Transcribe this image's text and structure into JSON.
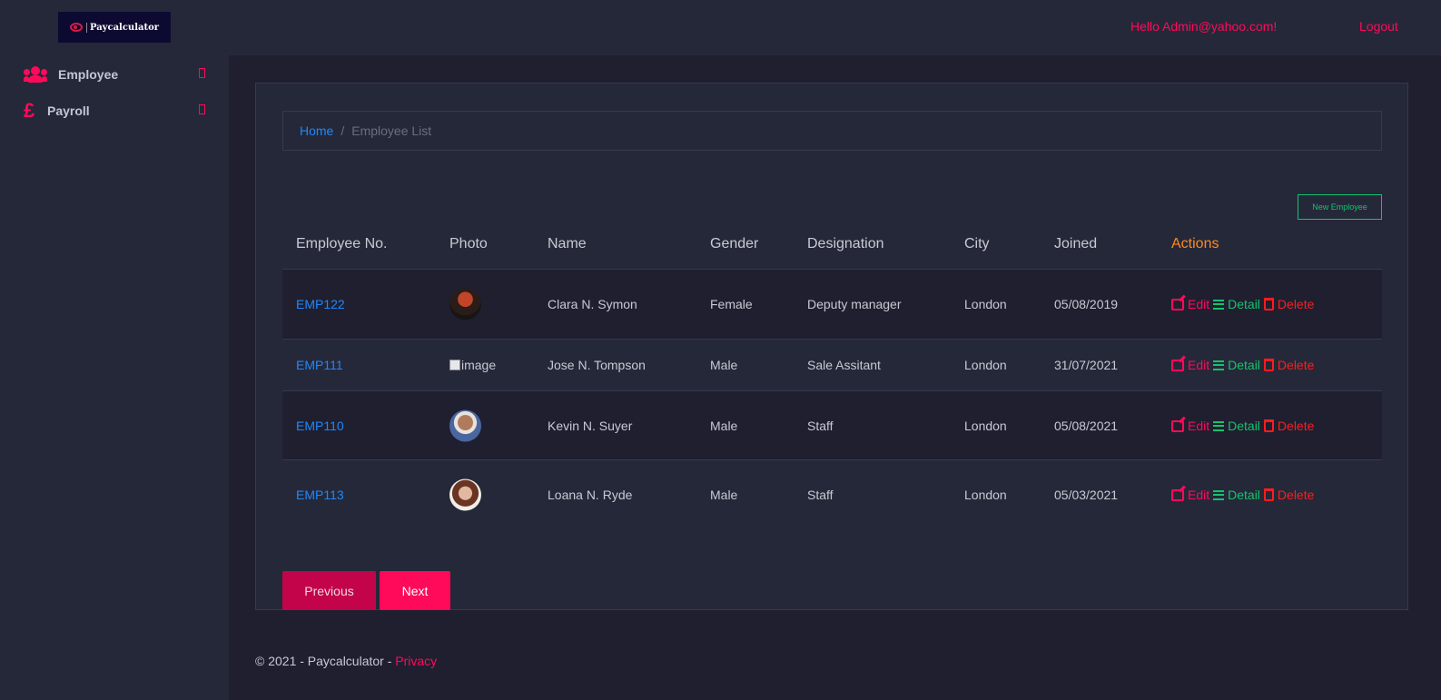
{
  "header": {
    "logo_text": "Paycalculator",
    "greeting": "Hello Admin@yahoo.com!",
    "logout_label": "Logout"
  },
  "sidebar": {
    "items": [
      {
        "label": "Employee",
        "icon": "users-icon"
      },
      {
        "label": "Payroll",
        "icon": "pound-icon"
      }
    ]
  },
  "breadcrumb": {
    "home": "Home",
    "separator": "/",
    "current": "Employee List"
  },
  "new_employee_label": "New Employee",
  "table": {
    "headers": [
      "Employee No.",
      "Photo",
      "Name",
      "Gender",
      "Designation",
      "City",
      "Joined",
      "Actions"
    ],
    "rows": [
      {
        "id": "EMP122",
        "photo": "avatar",
        "name": "Clara N. Symon",
        "gender": "Female",
        "designation": "Deputy manager",
        "city": "London",
        "joined": "05/08/2019"
      },
      {
        "id": "EMP111",
        "photo": "image",
        "name": "Jose N. Tompson",
        "gender": "Male",
        "designation": "Sale Assitant",
        "city": "London",
        "joined": "31/07/2021"
      },
      {
        "id": "EMP110",
        "photo": "avatar",
        "name": "Kevin N. Suyer",
        "gender": "Male",
        "designation": "Staff",
        "city": "London",
        "joined": "05/08/2021"
      },
      {
        "id": "EMP113",
        "photo": "avatar",
        "name": "Loana N. Ryde",
        "gender": "Male",
        "designation": "Staff",
        "city": "London",
        "joined": "05/03/2021"
      }
    ],
    "action_labels": {
      "edit": "Edit",
      "detail": "Detail",
      "delete": "Delete"
    }
  },
  "pagination": {
    "previous_label": "Previous",
    "next_label": "Next"
  },
  "footer": {
    "text": "© 2021 - Paycalculator - ",
    "privacy_label": "Privacy"
  },
  "colors": {
    "accent": "#ff0a5a",
    "link": "#1e88ff",
    "success": "#16c36b",
    "danger": "#ff1c1c",
    "actions_header": "#ff8a1e",
    "background": "#252839",
    "content_background": "#1f1f30"
  }
}
